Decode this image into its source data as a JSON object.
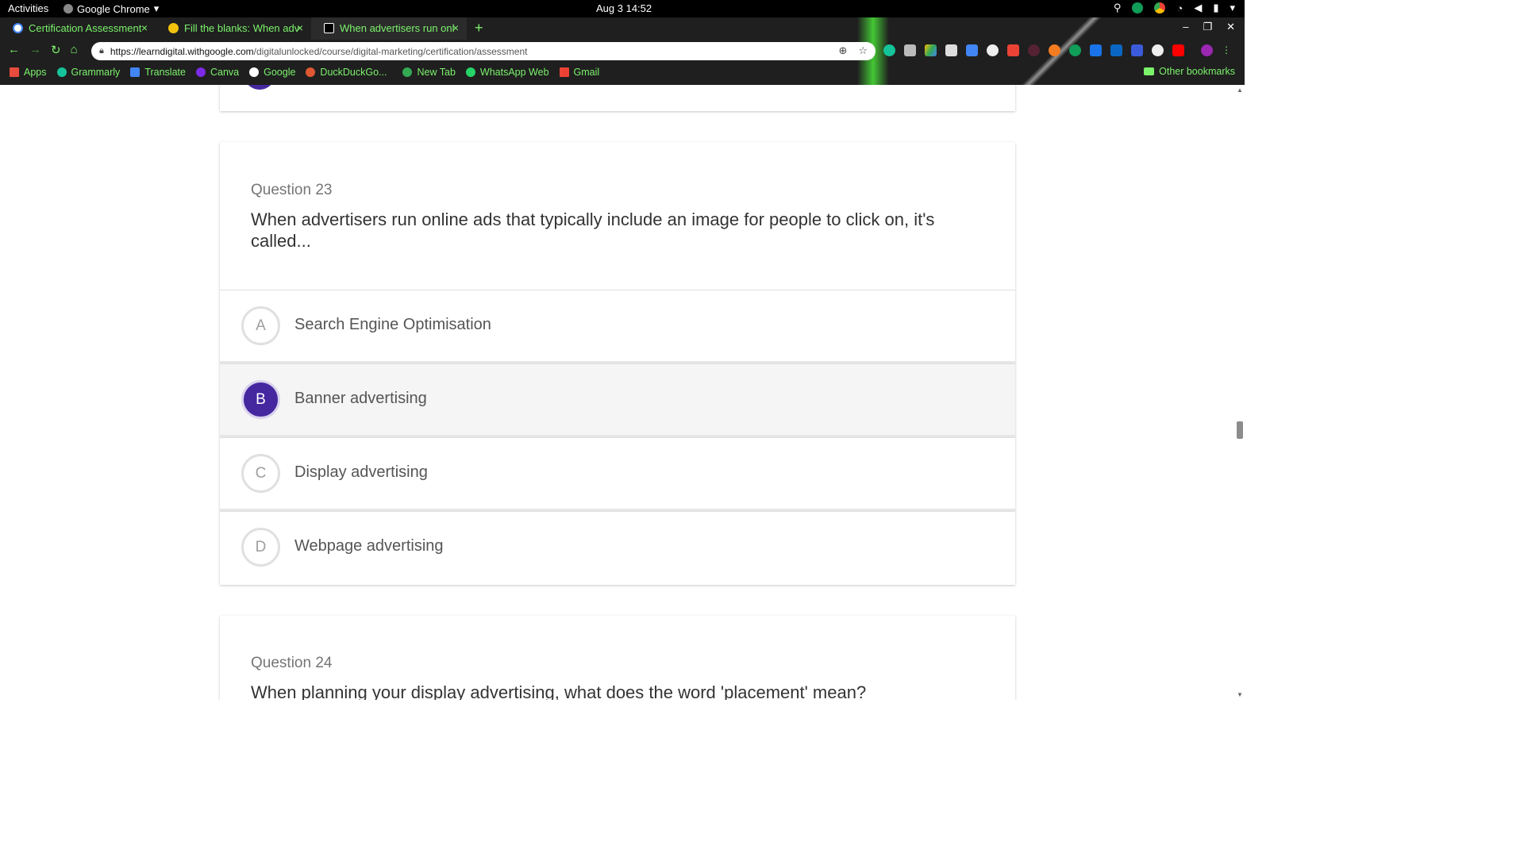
{
  "system_bar": {
    "activities": "Activities",
    "app_name": "Google Chrome",
    "clock": "Aug 3  14:52"
  },
  "browser": {
    "tabs": [
      {
        "title": "Certification Assessment",
        "active": false
      },
      {
        "title": "Fill the blanks: When adv",
        "active": false
      },
      {
        "title": "When advertisers run onl",
        "active": true
      }
    ],
    "url_host": "https://learndigital.withgoogle.com",
    "url_path": "/digitalunlocked/course/digital-marketing/certification/assessment",
    "bookmarks": [
      {
        "label": "Apps",
        "color": "#e74c3c"
      },
      {
        "label": "Grammarly",
        "color": "#15c39a"
      },
      {
        "label": "Translate",
        "color": "#4285f4"
      },
      {
        "label": "Canva",
        "color": "#7d2ae8"
      },
      {
        "label": "Google",
        "color": "#ffffff"
      },
      {
        "label": "DuckDuckGo...",
        "color": "#de5833"
      },
      {
        "label": "New Tab",
        "color": "#34a853"
      },
      {
        "label": "WhatsApp Web",
        "color": "#25d366"
      },
      {
        "label": "Gmail",
        "color": "#ea4335"
      }
    ],
    "other_bookmarks": "Other bookmarks"
  },
  "quiz": {
    "question_23": {
      "number": "Question 23",
      "text": "When advertisers run online ads that typically include an image for people to click on, it's called...",
      "options": [
        {
          "letter": "A",
          "label": "Search Engine Optimisation",
          "selected": false
        },
        {
          "letter": "B",
          "label": "Banner advertising",
          "selected": true
        },
        {
          "letter": "C",
          "label": "Display advertising",
          "selected": false
        },
        {
          "letter": "D",
          "label": "Webpage advertising",
          "selected": false
        }
      ]
    },
    "question_24": {
      "number": "Question 24",
      "text": "When planning your display advertising, what does the word 'placement' mean?"
    }
  },
  "colors": {
    "accent": "#4527a0",
    "chrome_text": "#7bf26b"
  }
}
